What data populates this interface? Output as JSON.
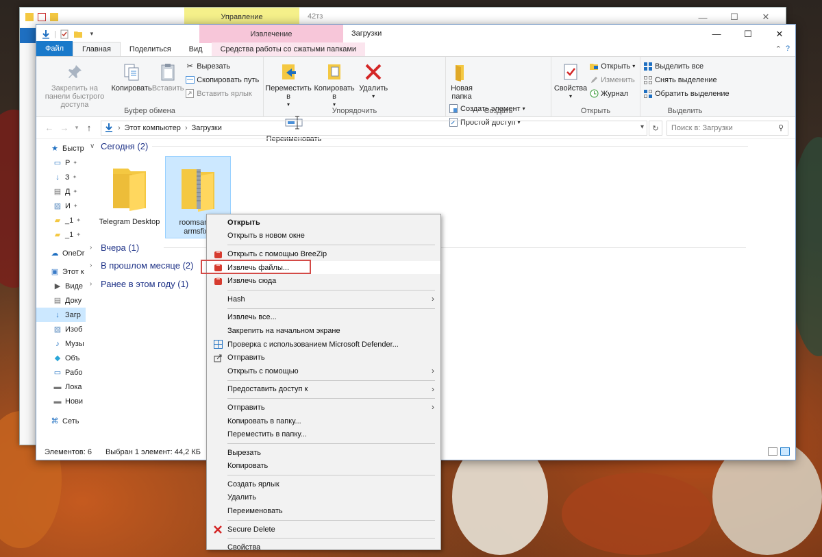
{
  "back_window": {
    "context_tab": "Управление",
    "title": "42тз"
  },
  "window": {
    "context_tab": "Извлечение",
    "title": "Загрузки",
    "controls": {
      "minimize": "—",
      "maximize": "☐",
      "close": "✕"
    }
  },
  "ribbon_tabs": {
    "file": "Файл",
    "home": "Главная",
    "share": "Поделиться",
    "view": "Вид",
    "compressed": "Средства работы со сжатыми папками"
  },
  "ribbon": {
    "clipboard": {
      "label": "Буфер обмена",
      "pin": "Закрепить на панели быстрого доступа",
      "copy": "Копировать",
      "paste": "Вставить",
      "cut": "Вырезать",
      "copy_path": "Скопировать путь",
      "paste_shortcut": "Вставить ярлык"
    },
    "organize": {
      "label": "Упорядочить",
      "move_to": "Переместить в",
      "copy_to": "Копировать в",
      "delete": "Удалить",
      "rename": "Переименовать"
    },
    "create": {
      "label": "Создать",
      "new_folder": "Новая папка",
      "new_item": "Создать элемент",
      "easy_access": "Простой доступ"
    },
    "open": {
      "label": "Открыть",
      "properties": "Свойства",
      "open": "Открыть",
      "edit": "Изменить",
      "history": "Журнал"
    },
    "select": {
      "label": "Выделить",
      "select_all": "Выделить все",
      "select_none": "Снять выделение",
      "invert": "Обратить выделение"
    }
  },
  "address": {
    "path": [
      "Этот компьютер",
      "Загрузки"
    ],
    "search_placeholder": "Поиск в: Загрузки"
  },
  "nav_pane": {
    "items": [
      {
        "label": "Быстр",
        "icon": "star-icon"
      },
      {
        "label": "Р",
        "icon": "desktop-icon"
      },
      {
        "label": "З",
        "icon": "download-icon"
      },
      {
        "label": "Д",
        "icon": "document-icon"
      },
      {
        "label": "И",
        "icon": "image-icon"
      },
      {
        "label": "_1",
        "icon": "folder-icon"
      },
      {
        "label": "_1",
        "icon": "folder-icon"
      },
      {
        "label": "OneDr",
        "icon": "cloud-icon"
      },
      {
        "label": "Этот к",
        "icon": "computer-icon"
      },
      {
        "label": "Виде",
        "icon": "video-icon"
      },
      {
        "label": "Доку",
        "icon": "document-icon"
      },
      {
        "label": "Загр",
        "icon": "download-icon"
      },
      {
        "label": "Изоб",
        "icon": "image-icon"
      },
      {
        "label": "Музы",
        "icon": "music-icon"
      },
      {
        "label": "Объ",
        "icon": "cube-icon"
      },
      {
        "label": "Рабо",
        "icon": "desktop-icon"
      },
      {
        "label": "Лока",
        "icon": "drive-icon"
      },
      {
        "label": "Нови",
        "icon": "drive-icon"
      },
      {
        "label": "Сеть",
        "icon": "network-icon"
      }
    ]
  },
  "groups": {
    "today": "Сегодня (2)",
    "yesterday": "Вчера (1)",
    "last_month": "В прошлом месяце (2)",
    "this_year": "Ранее в этом году (1)"
  },
  "files": [
    {
      "name": "Telegram Desktop"
    },
    {
      "name": "roomsandd armsfix.."
    }
  ],
  "status": {
    "count": "Элементов: 6",
    "selection": "Выбран 1 элемент: 44,2 КБ"
  },
  "context_menu": {
    "open": "Открыть",
    "open_new_window": "Открыть в новом окне",
    "open_breezip": "Открыть с помощью BreeZip",
    "extract_files": "Извлечь файлы...",
    "extract_here": "Извлечь сюда",
    "hash": "Hash",
    "extract_all": "Извлечь все...",
    "pin_start": "Закрепить на начальном экране",
    "defender": "Проверка с использованием Microsoft Defender...",
    "share": "Отправить",
    "open_with": "Открыть с помощью",
    "give_access": "Предоставить доступ к",
    "send_to": "Отправить",
    "copy_to_folder": "Копировать в папку...",
    "move_to_folder": "Переместить в папку...",
    "cut": "Вырезать",
    "copy": "Копировать",
    "create_shortcut": "Создать ярлык",
    "delete": "Удалить",
    "rename": "Переименовать",
    "secure_delete": "Secure Delete",
    "properties": "Свойства"
  }
}
